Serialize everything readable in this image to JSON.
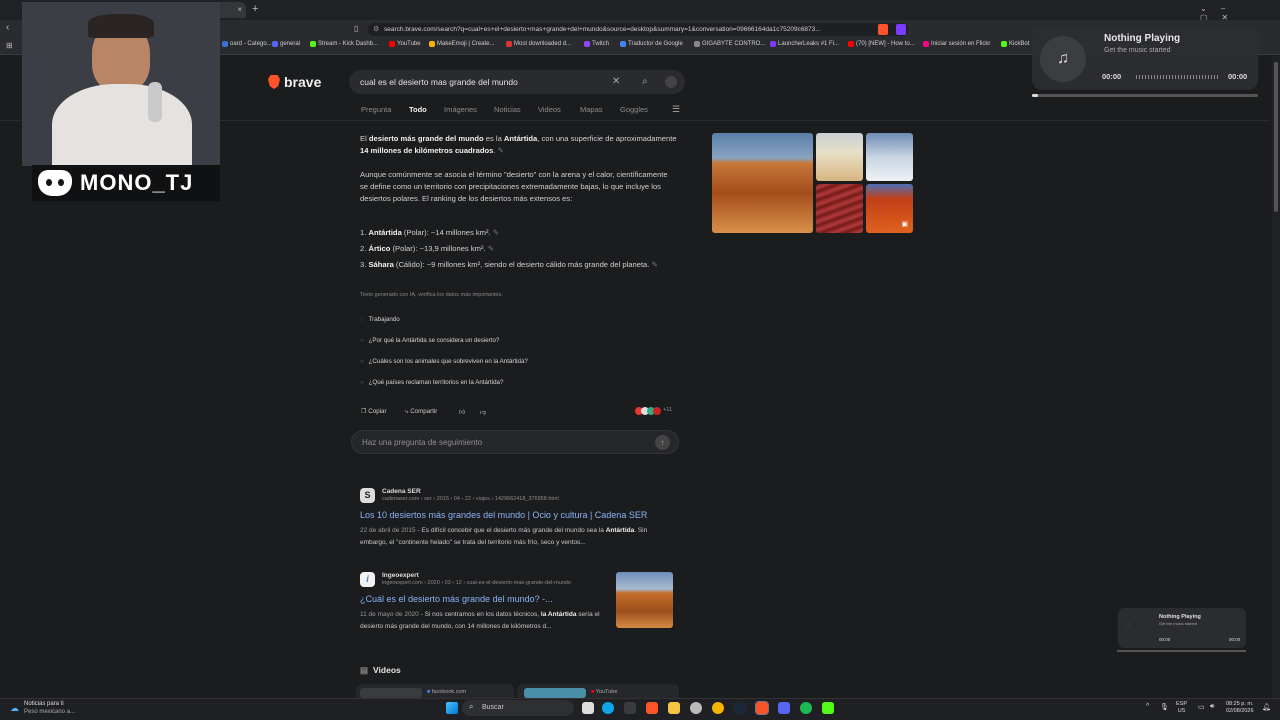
{
  "browser": {
    "active_tab_title": "",
    "new_tab": "+",
    "url": "search.brave.com/search?q=cual+es+el+desierto+mas+grande+del+mundo&source=desktop&summary=1&conversation=09666164da1c75209c6873...",
    "bookmarks": [
      {
        "label": "oard - Catego...",
        "color": "#3b6fd8"
      },
      {
        "label": "general",
        "color": "#5865f2"
      },
      {
        "label": "Stream - Kick Dashb...",
        "color": "#53fc18"
      },
      {
        "label": "YouTube",
        "color": "#ff0000"
      },
      {
        "label": "MakeEmoji | Create...",
        "color": "#f5b400"
      },
      {
        "label": "Most downloaded d...",
        "color": "#d33"
      },
      {
        "label": "Twitch",
        "color": "#9146ff"
      },
      {
        "label": "Traductor de Google",
        "color": "#4285f4"
      },
      {
        "label": "GIGABYTE CONTRO...",
        "color": "#888"
      },
      {
        "label": "LauncherLeaks #1 Fi...",
        "color": "#7a3cff"
      },
      {
        "label": "(70) [NEW] - How to...",
        "color": "#ff0000"
      },
      {
        "label": "Iniciar sesión en Flickr",
        "color": "#ff0084"
      },
      {
        "label": "KickBot",
        "color": "#53fc18"
      }
    ]
  },
  "brave": {
    "logo_text": "brave",
    "query": "cual es el desierto mas grande del mundo",
    "tabs": [
      {
        "label": "Pregunta",
        "active": false
      },
      {
        "label": "Todo",
        "active": true
      },
      {
        "label": "Imágenes",
        "active": false
      },
      {
        "label": "Noticias",
        "active": false
      },
      {
        "label": "Videos",
        "active": false
      },
      {
        "label": "Mapas",
        "active": false
      },
      {
        "label": "Goggles",
        "active": false
      }
    ]
  },
  "answer": {
    "p1_pre": "El ",
    "p1_bold1": "desierto más grande del mundo",
    "p1_mid": " es la ",
    "p1_bold2": "Antártida",
    "p1_mid2": ", con una superficie de aproximadamente ",
    "p1_bold3": "14 millones de kilómetros cuadrados",
    "p1_end": ".",
    "p2": "Aunque comúnmente se asocia el término \"desierto\" con la arena y el calor, científicamente se define como un territorio con precipitaciones extremadamente bajas, lo que incluye los desiertos polares. El ranking de los desiertos más extensos es:",
    "list": [
      {
        "num": "1.",
        "name": "Antártida",
        "rest": " (Polar): ~14 millones km²."
      },
      {
        "num": "2.",
        "name": "Ártico",
        "rest": " (Polar): ~13,9 millones km²."
      },
      {
        "num": "3.",
        "name": "Sáhara",
        "rest": " (Cálido): ~9 millones km², siendo el desierto cálido más grande del planeta."
      }
    ],
    "disclaimer": "Texto generado con IA, verifica los datos más importantes.",
    "working_label": "Trabajando",
    "suggestions": [
      "¿Por qué la Antártida se considera un desierto?",
      "¿Cuáles son los animales que sobreviven en la Antártida?",
      "¿Qué países reclaman territorios en la Antártida?"
    ],
    "copy_label": "Copiar",
    "share_label": "Compartir",
    "sources_count": "+11",
    "followup_placeholder": "Haz una pregunta de seguimiento"
  },
  "results": [
    {
      "site": "Cadena SER",
      "url": "cadenaser.com › ser › 2015 › 04 › 22 › viajes › 1429662418_376958.html",
      "title": "Los 10 desiertos más grandes del mundo | Ocio y cultura | Cadena SER",
      "date": "22 de abril de 2015",
      "snippet_a": " - Es difícil concebir que el desierto más grande del mundo sea la ",
      "snippet_b": "Antártida",
      "snippet_c": ". Sin embargo, el \"continente helado\" se trata del territorio más frío, seco y ventos..."
    },
    {
      "site": "Ingeoexpert",
      "url": "ingeoexpert.com › 2020 › 03 › 12 › cual-es-el-desierto-mas-grande-del-mundo",
      "title": "¿Cuál es el desierto más grande del mundo? -...",
      "date": "11 de mayo de 2020",
      "snippet_a": " - Si nos centramos en los datos técnicos, ",
      "snippet_b": "la Antártida",
      "snippet_c": " sería el desierto más grande del mundo, con 14 millones de kilómetros d..."
    }
  ],
  "videos_section": {
    "title": "Videos",
    "sources": [
      "facebook.com",
      "YouTube"
    ]
  },
  "overlay": {
    "discord_name": "MONO_TJ"
  },
  "music_widget": {
    "title": "Nothing Playing",
    "subtitle": "Get the music started",
    "time_start": "00:00",
    "time_end": "00:00"
  },
  "taskbar": {
    "news_title": "Noticias para ti",
    "news_sub": "Peso mexicano a...",
    "search_label": "Buscar",
    "lang": "ESP",
    "region": "US",
    "time": "08:25 p. m.",
    "date": "02/08/2026"
  }
}
